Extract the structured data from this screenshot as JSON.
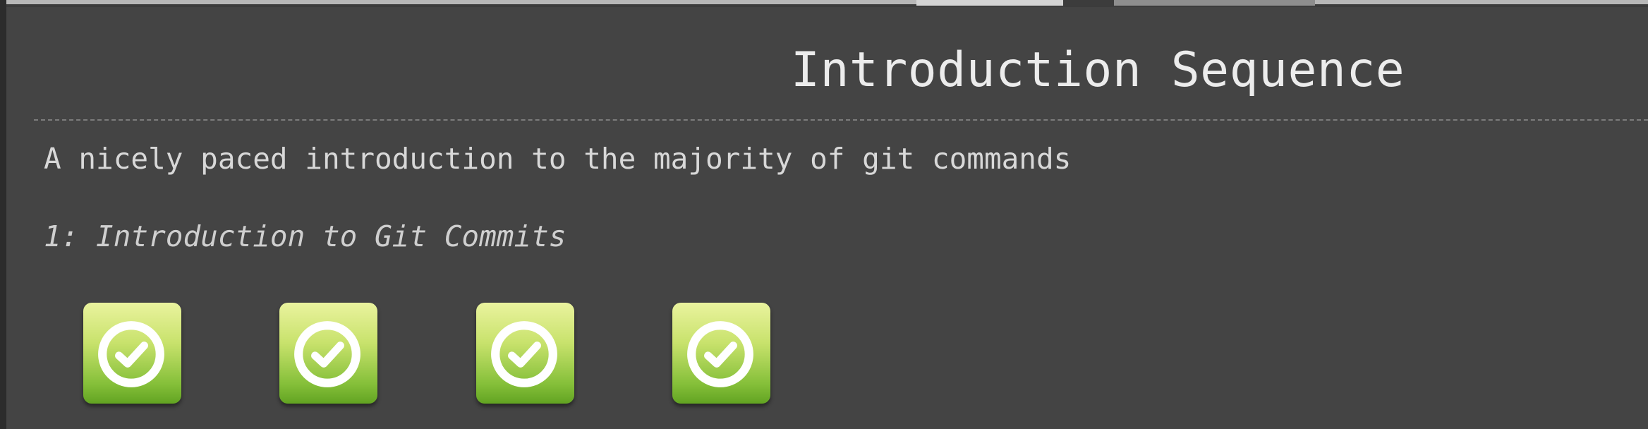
{
  "page": {
    "title": "Introduction Sequence",
    "description": "A nicely paced introduction to the majority of git commands"
  },
  "sequence": {
    "label": "1: Introduction to Git Commits",
    "levels": [
      {
        "status": "completed",
        "icon": "check-circle-icon"
      },
      {
        "status": "completed",
        "icon": "check-circle-icon"
      },
      {
        "status": "completed",
        "icon": "check-circle-icon"
      },
      {
        "status": "completed",
        "icon": "check-circle-icon"
      }
    ]
  },
  "colors": {
    "background": "#444444",
    "title_text": "#ececec",
    "tile_top": "#eaf39e",
    "tile_bottom": "#62a422"
  }
}
